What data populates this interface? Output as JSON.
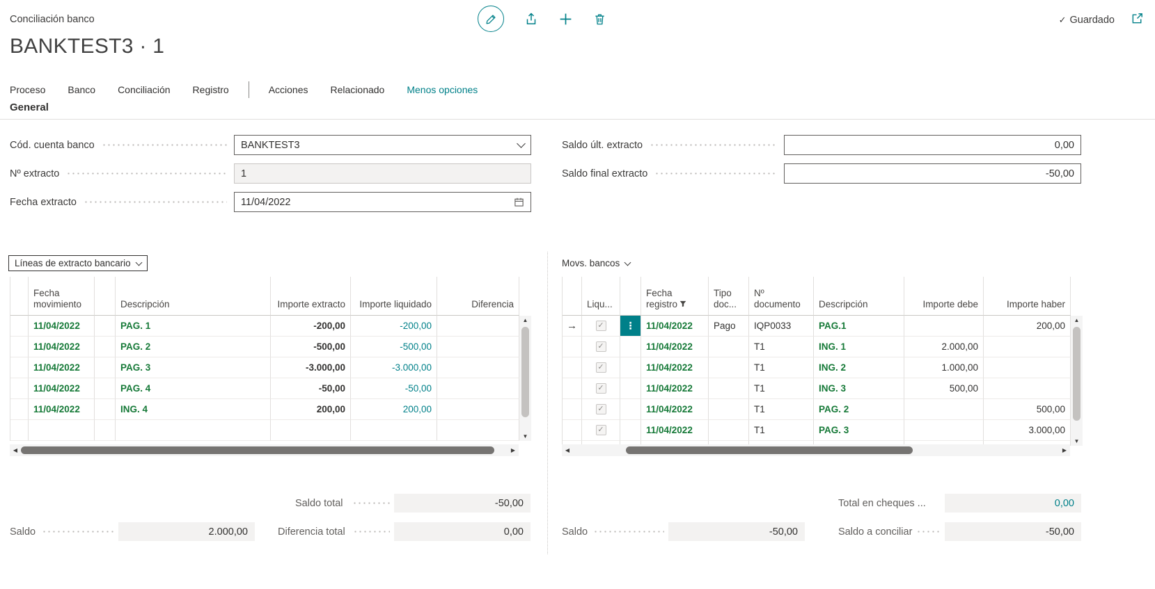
{
  "colors": {
    "accent": "#008089",
    "green": "#157937",
    "field_gray": "#f3f2f1"
  },
  "app": {
    "breadcrumb": "Conciliación banco",
    "title": "BANKTEST3 · 1",
    "saved": "Guardado"
  },
  "toolbar": {
    "icons": [
      "edit-icon",
      "share-icon",
      "add-icon",
      "delete-icon",
      "open-window-icon"
    ]
  },
  "menu": {
    "items": [
      "Proceso",
      "Banco",
      "Conciliación",
      "Registro",
      "Acciones",
      "Relacionado"
    ],
    "more": "Menos opciones"
  },
  "general": {
    "title": "General",
    "left": [
      {
        "label": "Cód. cuenta banco",
        "value": "BANKTEST3"
      },
      {
        "label": "Nº extracto",
        "value": "1"
      },
      {
        "label": "Fecha extracto",
        "value": "11/04/2022"
      }
    ],
    "right": [
      {
        "label": "Saldo últ. extracto",
        "value": "0,00"
      },
      {
        "label": "Saldo final extracto",
        "value": "-50,00"
      }
    ]
  },
  "statement_lines": {
    "caption": "Líneas de extracto bancario",
    "columns": [
      "Fecha movimiento",
      "Descripción",
      "Importe extracto",
      "Importe liquidado",
      "Diferencia"
    ],
    "rows": [
      {
        "fecha": "11/04/2022",
        "desc": "PAG. 1",
        "extracto": "-200,00",
        "liquidado": "-200,00",
        "dif": ""
      },
      {
        "fecha": "11/04/2022",
        "desc": "PAG. 2",
        "extracto": "-500,00",
        "liquidado": "-500,00",
        "dif": ""
      },
      {
        "fecha": "11/04/2022",
        "desc": "PAG. 3",
        "extracto": "-3.000,00",
        "liquidado": "-3.000,00",
        "dif": ""
      },
      {
        "fecha": "11/04/2022",
        "desc": "PAG. 4",
        "extracto": "-50,00",
        "liquidado": "-50,00",
        "dif": ""
      },
      {
        "fecha": "11/04/2022",
        "desc": "ING. 4",
        "extracto": "200,00",
        "liquidado": "200,00",
        "dif": ""
      }
    ],
    "totals": {
      "saldo_total_label": "Saldo total",
      "saldo_total": "-50,00",
      "saldo_label": "Saldo",
      "saldo": "2.000,00",
      "diferencia_label": "Diferencia total",
      "diferencia": "0,00"
    }
  },
  "bank_ledger": {
    "caption": "Movs. bancos",
    "columns": [
      "Liqu...",
      "Fecha registro",
      "Tipo doc...",
      "Nº documento",
      "Descripción",
      "Importe debe",
      "Importe haber"
    ],
    "rows": [
      {
        "current": true,
        "liq": true,
        "fecha": "11/04/2022",
        "tipo": "Pago",
        "ndoc": "IQP0033",
        "desc": "PAG.1",
        "debe": "",
        "haber": "200,00"
      },
      {
        "current": false,
        "liq": true,
        "fecha": "11/04/2022",
        "tipo": "",
        "ndoc": "T1",
        "desc": "ING. 1",
        "debe": "2.000,00",
        "haber": ""
      },
      {
        "current": false,
        "liq": true,
        "fecha": "11/04/2022",
        "tipo": "",
        "ndoc": "T1",
        "desc": "ING. 2",
        "debe": "1.000,00",
        "haber": ""
      },
      {
        "current": false,
        "liq": true,
        "fecha": "11/04/2022",
        "tipo": "",
        "ndoc": "T1",
        "desc": "ING. 3",
        "debe": "500,00",
        "haber": ""
      },
      {
        "current": false,
        "liq": true,
        "fecha": "11/04/2022",
        "tipo": "",
        "ndoc": "T1",
        "desc": "PAG. 2",
        "debe": "",
        "haber": "500,00"
      },
      {
        "current": false,
        "liq": true,
        "fecha": "11/04/2022",
        "tipo": "",
        "ndoc": "T1",
        "desc": "PAG. 3",
        "debe": "",
        "haber": "3.000,00"
      }
    ],
    "totals": {
      "cheques_label": "Total en cheques ...",
      "cheques": "0,00",
      "saldo_label": "Saldo",
      "saldo": "-50,00",
      "conciliar_label": "Saldo a conciliar",
      "conciliar": "-50,00"
    }
  }
}
